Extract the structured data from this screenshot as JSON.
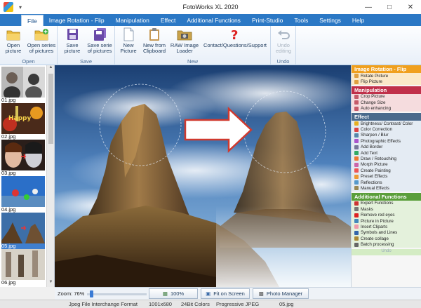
{
  "window": {
    "title": "FotoWorks XL 2020",
    "quick_access": "▾"
  },
  "menu": {
    "tabs": [
      "File",
      "Image Rotation - Flip",
      "Manipulation",
      "Effect",
      "Additional Functions",
      "Print-Studio",
      "Tools",
      "Settings",
      "Help"
    ],
    "active": "File"
  },
  "ribbon": {
    "open_group": {
      "label": "Open",
      "open_picture": "Open\npicture",
      "open_series": "Open series\nof pictures"
    },
    "save_group": {
      "label": "Save",
      "save_picture": "Save\npicture",
      "save_series": "Save serie\nof pictures"
    },
    "new_group": {
      "label": "New",
      "new_picture": "New\nPicture",
      "new_clipboard": "New from\nClipboard",
      "raw_loader": "RAW Image\nLoader",
      "contact": "Contact/Questions/Support"
    },
    "undo_group": {
      "label": "Undo",
      "undo_editing": "Undo\nediting"
    }
  },
  "thumbnails": [
    {
      "label": "01.jpg"
    },
    {
      "label": "02.jpg"
    },
    {
      "label": "03.jpg"
    },
    {
      "label": "04.jpg"
    },
    {
      "label": "05.jpg"
    },
    {
      "label": "06.jpg"
    }
  ],
  "thumb_text": "Happy",
  "right_panel": {
    "rotation": {
      "title": "Image Rotation - Flip",
      "items": [
        "Rotate Picture",
        "Flip Picture"
      ]
    },
    "manipulation": {
      "title": "Manipulation",
      "items": [
        "Crop Picture",
        "Change Size",
        "Auto enhancing"
      ]
    },
    "effect": {
      "title": "Effect",
      "items": [
        "Brightness/ Contrast/ Color",
        "Color Correction",
        "Sharpen / Blur",
        "Photographic Effects",
        "Add Border",
        "Add Text",
        "Draw / Retouching",
        "Morph Picture",
        "Create Painting",
        "Preset Effects",
        "Reflections",
        "Manual Effects"
      ]
    },
    "additional": {
      "title": "Additional Functions",
      "items": [
        "Expert Functions",
        "Masks",
        "Remove red eyes",
        "Picture in Picture",
        "Insert Cliparts",
        "Symbols and Lines",
        "Create collage",
        "Batch processing"
      ]
    },
    "undo_label": "Undo"
  },
  "bottom": {
    "zoom_label": "Zoom: 76%",
    "zoom_fraction": 0.05,
    "btn_100": "100%",
    "btn_fit": "Fit on Screen",
    "btn_manager": "Photo Manager"
  },
  "status": {
    "format": "Jpeg File Interchange Format",
    "dims": "1001x680",
    "colors": "24Bit Colors",
    "encoding": "Progressive JPEG",
    "filename": "05.jpg"
  },
  "colors": {
    "menu_blue": "#2b78c5",
    "rotation_orange": "#f0a01e",
    "manipulation_red": "#c0304a",
    "effect_blue": "#4a6a8c",
    "additional_green": "#5a9e3a",
    "arrow_red": "#d0392e"
  }
}
